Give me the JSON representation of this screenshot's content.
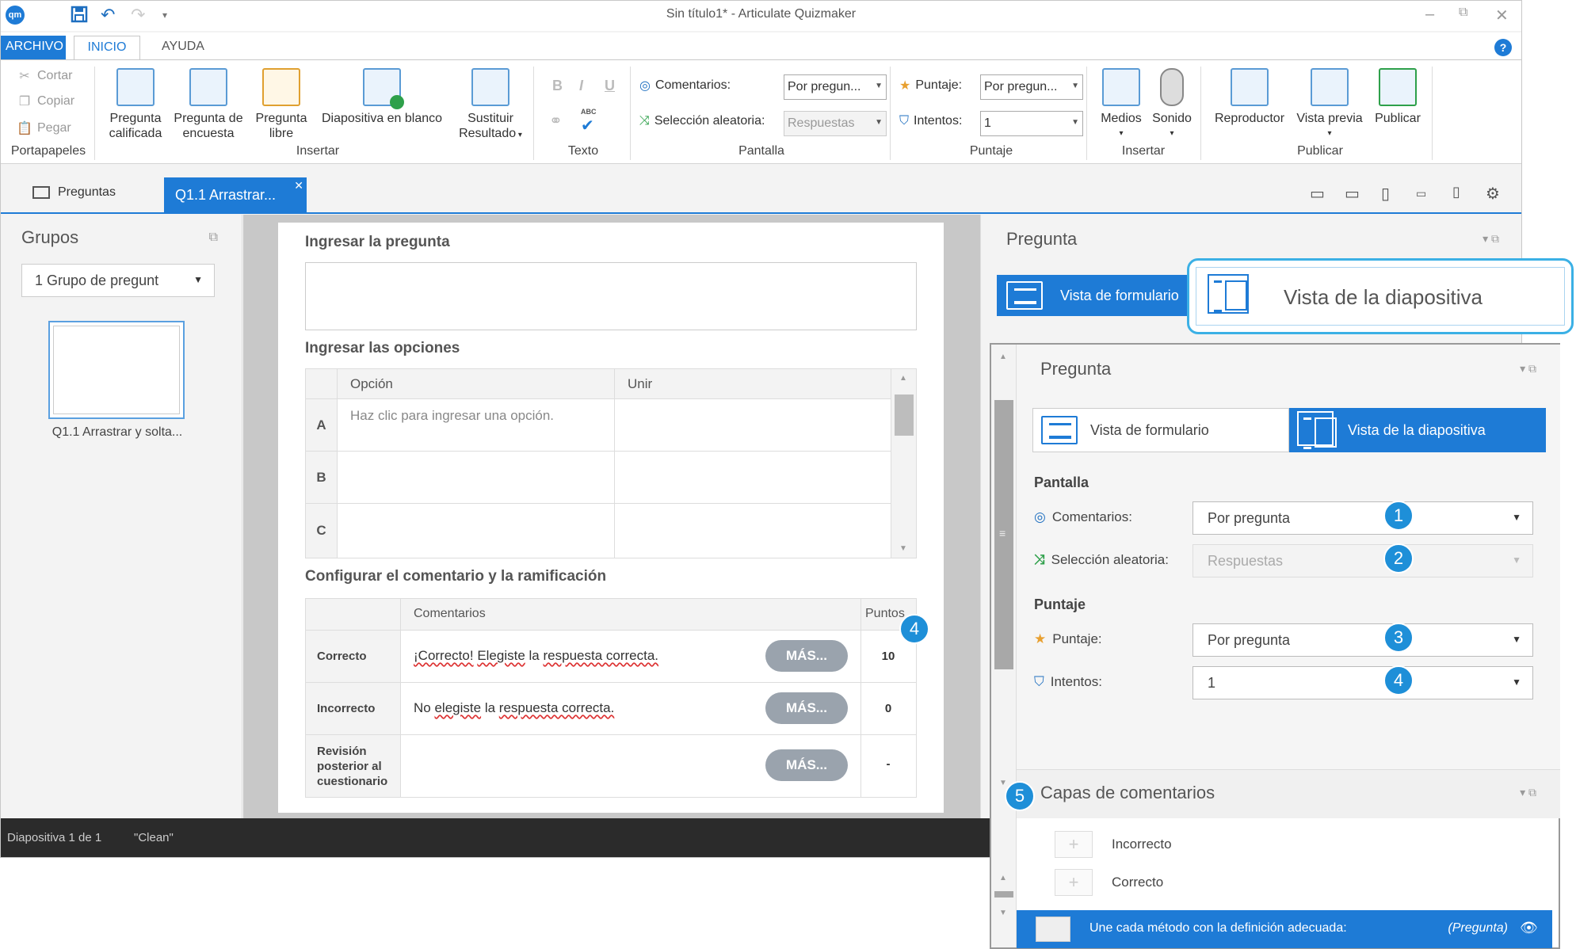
{
  "window": {
    "title": "Sin título1* -  Articulate Quizmaker",
    "logo": "qm"
  },
  "ribbon_tabs": [
    "ARCHIVO",
    "INICIO",
    "AYUDA"
  ],
  "ribbon": {
    "clipboard": {
      "cut": "Cortar",
      "copy": "Copiar",
      "paste": "Pegar",
      "group": "Portapapeles"
    },
    "insert": {
      "graded": [
        "Pregunta",
        "calificada"
      ],
      "survey": [
        "Pregunta de",
        "encuesta"
      ],
      "freeform": [
        "Pregunta",
        "libre"
      ],
      "blank": "Diapositiva en blanco",
      "result": [
        "Sustituir",
        "Resultado"
      ],
      "group": "Insertar"
    },
    "text": {
      "bold": "B",
      "italic": "I",
      "underline": "U",
      "spell": "ABC",
      "group": "Texto"
    },
    "display": {
      "feedback_label": "Comentarios:",
      "feedback_value": "Por pregun...",
      "shuffle_label": "Selección aleatoria:",
      "shuffle_value": "Respuestas",
      "group": "Pantalla"
    },
    "scoring": {
      "points_label": "Puntaje:",
      "points_value": "Por pregun...",
      "attempts_label": "Intentos:",
      "attempts_value": "1",
      "group": "Puntaje"
    },
    "media": {
      "media": "Medios",
      "sound": "Sonido",
      "group": "Insertar"
    },
    "publish": {
      "player": "Reproductor",
      "preview": "Vista previa",
      "publish": "Publicar",
      "group": "Publicar"
    }
  },
  "doc_tabs": {
    "questions": "Preguntas",
    "active": "Q1.1 Arrastrar..."
  },
  "left_panel": {
    "title": "Grupos",
    "group_select": "1 Grupo de pregunt",
    "slide_label": "Q1.1 Arrastrar y solta..."
  },
  "form": {
    "question_title": "Ingresar la pregunta",
    "options_title": "Ingresar las opciones",
    "options_headers": [
      "Opción",
      "Unir"
    ],
    "options": [
      {
        "letter": "A",
        "text": "Haz clic para ingresar una opción."
      },
      {
        "letter": "B",
        "text": ""
      },
      {
        "letter": "C",
        "text": ""
      }
    ],
    "feedback_title": "Configurar el comentario y la ramificación",
    "feedback_headers": {
      "comments": "Comentarios",
      "points": "Puntos"
    },
    "feedback_rows": [
      {
        "label": "Correcto",
        "text_a": "¡Correcto!",
        "text_b": "Elegiste",
        "text_c": "la",
        "text_d": "respuesta correcta.",
        "button": "MÁS...",
        "points": "10"
      },
      {
        "label": "Incorrecto",
        "text_a": "No",
        "text_b": "elegiste",
        "text_c": "la",
        "text_d": "respuesta correcta.",
        "button": "MÁS...",
        "points": "0"
      },
      {
        "label": "Revisión posterior al cuestionario",
        "button": "MÁS...",
        "points": "-"
      }
    ]
  },
  "status": {
    "slide": "Diapositiva 1 de 1",
    "theme": "\"Clean\""
  },
  "right_panel": {
    "title": "Pregunta",
    "form_view": "Vista de formulario",
    "slide_view_callout": "Vista de la diapositiva"
  },
  "zoom_panel": {
    "section_title": "Pregunta",
    "form_view": "Vista de formulario",
    "slide_view": "Vista de la diapositiva",
    "display_label": "Pantalla",
    "feedback_label": "Comentarios:",
    "feedback_value": "Por pregunta",
    "shuffle_label": "Selección aleatoria:",
    "shuffle_value": "Respuestas",
    "scoring_label": "Puntaje",
    "points_label": "Puntaje:",
    "points_value": "Por pregunta",
    "attempts_label": "Intentos:",
    "attempts_value": "1",
    "layers_title": "Capas de comentarios",
    "layers": [
      "Incorrecto",
      "Correcto"
    ],
    "bottom_text": "Une cada método con la definición adecuada:",
    "bottom_tag": "(Pregunta)"
  },
  "badges": [
    "1",
    "2",
    "3",
    "4",
    "4",
    "5"
  ],
  "colors": {
    "accent": "#1e7bd6",
    "badge": "#1e8fd8",
    "callout": "#3bb0e5",
    "status_bar": "#2b2b2b"
  }
}
